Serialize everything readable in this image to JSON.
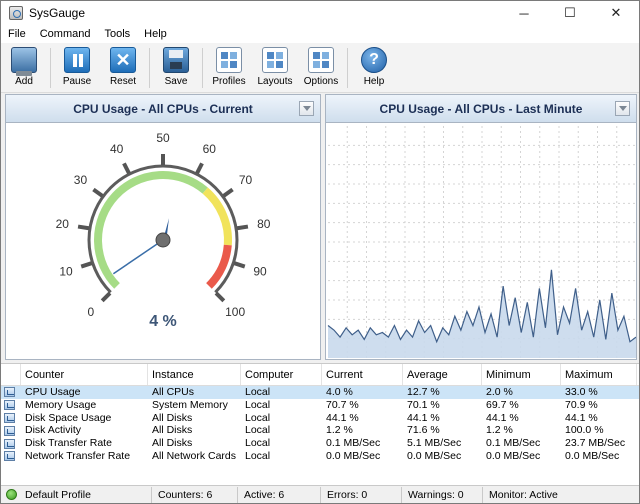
{
  "window": {
    "title": "SysGauge",
    "minimize": "─",
    "maximize": "☐",
    "close": "✕"
  },
  "menu": [
    "File",
    "Command",
    "Tools",
    "Help"
  ],
  "toolbar": {
    "add": "Add",
    "pause": "Pause",
    "reset": "Reset",
    "save": "Save",
    "profiles": "Profiles",
    "layouts": "Layouts",
    "options": "Options",
    "help": "Help",
    "reset_glyph": "✕",
    "help_glyph": "?"
  },
  "gauge_panel": {
    "title": "CPU Usage - All CPUs - Current",
    "value_label": "4 %",
    "value": 4,
    "scale_min": 0,
    "scale_max": 100,
    "ticks": [
      "0",
      "10",
      "20",
      "30",
      "40",
      "50",
      "60",
      "70",
      "80",
      "90",
      "100"
    ],
    "zone_colors": {
      "green": "#a6dc86",
      "yellow": "#f1e35c",
      "red": "#ea5a4b"
    }
  },
  "history_panel": {
    "title": "CPU Usage - All CPUs - Last Minute",
    "series": [
      14,
      12,
      9,
      13,
      10,
      12,
      8,
      13,
      10,
      11,
      9,
      14,
      8,
      12,
      9,
      16,
      11,
      14,
      7,
      13,
      10,
      18,
      12,
      20,
      14,
      22,
      11,
      19,
      9,
      31,
      14,
      26,
      11,
      24,
      9,
      30,
      13,
      38,
      10,
      22,
      15,
      30,
      12,
      20,
      9,
      25,
      8,
      28,
      12,
      18,
      7,
      9
    ]
  },
  "table": {
    "columns": [
      "Counter",
      "Instance",
      "Computer",
      "Current",
      "Average",
      "Minimum",
      "Maximum"
    ],
    "rows": [
      [
        "CPU Usage",
        "All CPUs",
        "Local",
        "4.0 %",
        "12.7 %",
        "2.0 %",
        "33.0 %"
      ],
      [
        "Memory Usage",
        "System Memory",
        "Local",
        "70.7 %",
        "70.1 %",
        "69.7 %",
        "70.9 %"
      ],
      [
        "Disk Space Usage",
        "All Disks",
        "Local",
        "44.1 %",
        "44.1 %",
        "44.1 %",
        "44.1 %"
      ],
      [
        "Disk Activity",
        "All Disks",
        "Local",
        "1.2 %",
        "71.6 %",
        "1.2 %",
        "100.0 %"
      ],
      [
        "Disk Transfer Rate",
        "All Disks",
        "Local",
        "0.1 MB/Sec",
        "5.1 MB/Sec",
        "0.1 MB/Sec",
        "23.7 MB/Sec"
      ],
      [
        "Network Transfer Rate",
        "All Network Cards",
        "Local",
        "0.0 MB/Sec",
        "0.0 MB/Sec",
        "0.0 MB/Sec",
        "0.0 MB/Sec"
      ]
    ]
  },
  "status": {
    "profile": "Default Profile",
    "counters": "Counters: 6",
    "active": "Active: 6",
    "errors": "Errors: 0",
    "warnings": "Warnings: 0",
    "monitor": "Monitor: Active"
  }
}
